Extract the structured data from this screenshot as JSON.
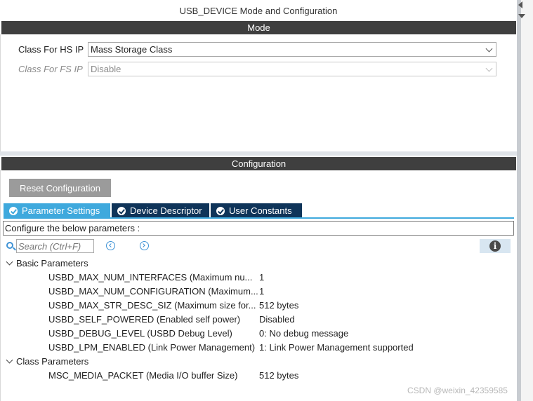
{
  "window": {
    "title": "USB_DEVICE Mode and Configuration"
  },
  "mode": {
    "header": "Mode",
    "fields": [
      {
        "label": "Class For HS IP",
        "value": "Mass Storage Class",
        "enabled": true
      },
      {
        "label": "Class For FS IP",
        "value": "Disable",
        "enabled": false
      }
    ]
  },
  "configuration": {
    "header": "Configuration",
    "reset_label": "Reset Configuration",
    "tabs": [
      {
        "label": "Parameter Settings",
        "active": true
      },
      {
        "label": "Device Descriptor",
        "active": false
      },
      {
        "label": "User Constants",
        "active": false
      }
    ],
    "instruction": "Configure the below parameters :",
    "search_placeholder": "Search (Ctrl+F)",
    "groups": [
      {
        "name": "Basic Parameters",
        "expanded": true,
        "params": [
          {
            "name": "USBD_MAX_NUM_INTERFACES (Maximum nu...",
            "value": "1"
          },
          {
            "name": "USBD_MAX_NUM_CONFIGURATION (Maximum...",
            "value": "1"
          },
          {
            "name": "USBD_MAX_STR_DESC_SIZ (Maximum size for...",
            "value": "512 bytes"
          },
          {
            "name": "USBD_SELF_POWERED (Enabled self power)",
            "value": "Disabled"
          },
          {
            "name": "USBD_DEBUG_LEVEL (USBD Debug Level)",
            "value": "0: No debug message"
          },
          {
            "name": "USBD_LPM_ENABLED (Link Power Management)",
            "value": "1: Link Power Management supported"
          }
        ]
      },
      {
        "name": "Class Parameters",
        "expanded": true,
        "params": [
          {
            "name": "MSC_MEDIA_PACKET (Media I/O buffer Size)",
            "value": "512 bytes"
          }
        ]
      }
    ]
  },
  "watermark": "CSDN @weixin_42359585",
  "colors": {
    "section_header": "#3f3f3f",
    "tab_active": "#3fa9dd",
    "tab_inactive": "#0f3459",
    "reset_button": "#9b9b9b",
    "icon_accent": "#3f93d6"
  },
  "icons": [
    "search-icon",
    "arrow-left-circle-icon",
    "arrow-right-circle-icon",
    "info-icon",
    "check-circle-icon",
    "chevron-down-icon"
  ]
}
